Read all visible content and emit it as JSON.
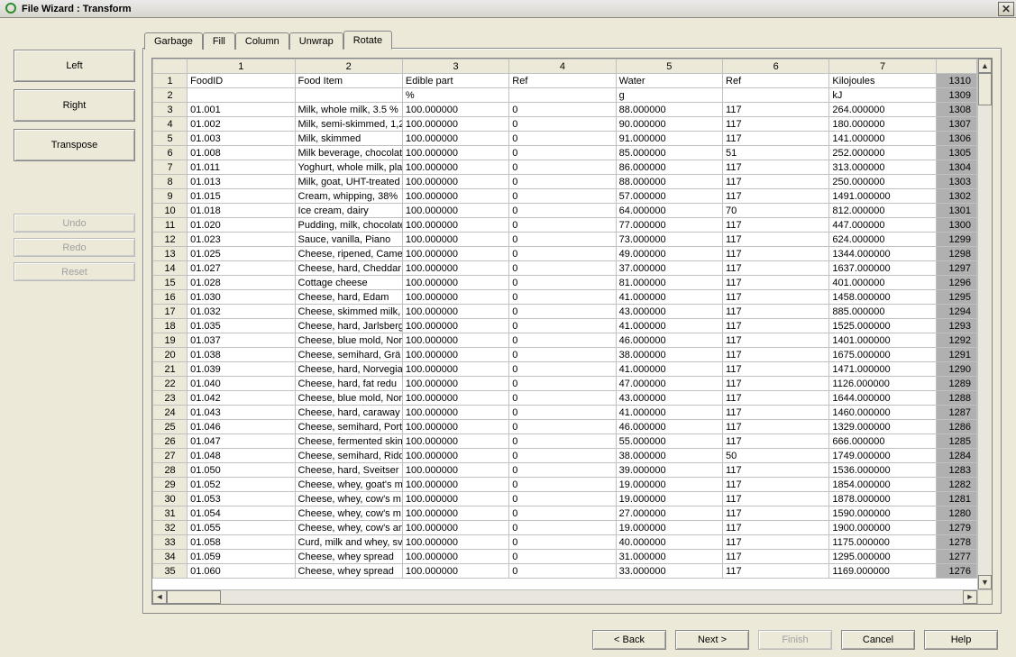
{
  "window": {
    "title": "File Wizard : Transform"
  },
  "sidebar": {
    "buttons": [
      "Left",
      "Right",
      "Transpose"
    ],
    "edit": [
      "Undo",
      "Redo",
      "Reset"
    ]
  },
  "tabs": [
    "Garbage",
    "Fill",
    "Column",
    "Unwrap",
    "Rotate"
  ],
  "active_tab": 4,
  "bottom": {
    "back": "< Back",
    "next": "Next >",
    "finish": "Finish",
    "cancel": "Cancel",
    "help": "Help"
  },
  "grid": {
    "col_headers": [
      "",
      "1",
      "2",
      "3",
      "4",
      "5",
      "6",
      "7",
      ""
    ],
    "counter_start": 1310,
    "rows": [
      {
        "n": "1",
        "c": [
          "FoodID",
          "Food Item",
          "Edible part",
          "Ref",
          "Water",
          "Ref",
          "Kilojoules"
        ]
      },
      {
        "n": "2",
        "c": [
          "",
          "",
          "%",
          "",
          "g",
          "",
          "kJ"
        ]
      },
      {
        "n": "3",
        "c": [
          "01.001",
          "Milk, whole milk, 3.5 %",
          "100.000000",
          "0",
          "88.000000",
          "117",
          "264.000000"
        ]
      },
      {
        "n": "4",
        "c": [
          "01.002",
          "Milk, semi-skimmed, 1,2",
          "100.000000",
          "0",
          "90.000000",
          "117",
          "180.000000"
        ]
      },
      {
        "n": "5",
        "c": [
          "01.003",
          "Milk, skimmed",
          "100.000000",
          "0",
          "91.000000",
          "117",
          "141.000000"
        ]
      },
      {
        "n": "6",
        "c": [
          "01.008",
          "Milk beverage, chocolat",
          "100.000000",
          "0",
          "85.000000",
          "51",
          "252.000000"
        ]
      },
      {
        "n": "7",
        "c": [
          "01.011",
          "Yoghurt, whole milk, pla",
          "100.000000",
          "0",
          "86.000000",
          "117",
          "313.000000"
        ]
      },
      {
        "n": "8",
        "c": [
          "01.013",
          "Milk, goat, UHT-treated",
          "100.000000",
          "0",
          "88.000000",
          "117",
          "250.000000"
        ]
      },
      {
        "n": "9",
        "c": [
          "01.015",
          "Cream, whipping, 38%",
          "100.000000",
          "0",
          "57.000000",
          "117",
          "1491.000000"
        ]
      },
      {
        "n": "10",
        "c": [
          "01.018",
          "Ice cream, dairy",
          "100.000000",
          "0",
          "64.000000",
          "70",
          "812.000000"
        ]
      },
      {
        "n": "11",
        "c": [
          "01.020",
          "Pudding, milk, chocolate",
          "100.000000",
          "0",
          "77.000000",
          "117",
          "447.000000"
        ]
      },
      {
        "n": "12",
        "c": [
          "01.023",
          "Sauce, vanilla, Piano",
          "100.000000",
          "0",
          "73.000000",
          "117",
          "624.000000"
        ]
      },
      {
        "n": "13",
        "c": [
          "01.025",
          "Cheese, ripened, Came",
          "100.000000",
          "0",
          "49.000000",
          "117",
          "1344.000000"
        ]
      },
      {
        "n": "14",
        "c": [
          "01.027",
          "Cheese, hard, Cheddar",
          "100.000000",
          "0",
          "37.000000",
          "117",
          "1637.000000"
        ]
      },
      {
        "n": "15",
        "c": [
          "01.028",
          "Cottage cheese",
          "100.000000",
          "0",
          "81.000000",
          "117",
          "401.000000"
        ]
      },
      {
        "n": "16",
        "c": [
          "01.030",
          "Cheese, hard, Edam",
          "100.000000",
          "0",
          "41.000000",
          "117",
          "1458.000000"
        ]
      },
      {
        "n": "17",
        "c": [
          "01.032",
          "Cheese,  skimmed milk,",
          "100.000000",
          "0",
          "43.000000",
          "117",
          "885.000000"
        ]
      },
      {
        "n": "18",
        "c": [
          "01.035",
          "Cheese, hard, Jarlsberg",
          "100.000000",
          "0",
          "41.000000",
          "117",
          "1525.000000"
        ]
      },
      {
        "n": "19",
        "c": [
          "01.037",
          "Cheese, blue mold, Nor",
          "100.000000",
          "0",
          "46.000000",
          "117",
          "1401.000000"
        ]
      },
      {
        "n": "20",
        "c": [
          "01.038",
          "Cheese, semihard, Grä",
          "100.000000",
          "0",
          "38.000000",
          "117",
          "1675.000000"
        ]
      },
      {
        "n": "21",
        "c": [
          "01.039",
          "Cheese, hard, Norvegia",
          "100.000000",
          "0",
          "41.000000",
          "117",
          "1471.000000"
        ]
      },
      {
        "n": "22",
        "c": [
          "01.040",
          "Cheese, hard, fat redu",
          "100.000000",
          "0",
          "47.000000",
          "117",
          "1126.000000"
        ]
      },
      {
        "n": "23",
        "c": [
          "01.042",
          "Cheese, blue mold, Nor",
          "100.000000",
          "0",
          "43.000000",
          "117",
          "1644.000000"
        ]
      },
      {
        "n": "24",
        "c": [
          "01.043",
          "Cheese, hard, caraway",
          "100.000000",
          "0",
          "41.000000",
          "117",
          "1460.000000"
        ]
      },
      {
        "n": "25",
        "c": [
          "01.046",
          "Cheese, semihard, Port",
          "100.000000",
          "0",
          "46.000000",
          "117",
          "1329.000000"
        ]
      },
      {
        "n": "26",
        "c": [
          "01.047",
          "Cheese, fermented skin",
          "100.000000",
          "0",
          "55.000000",
          "117",
          "666.000000"
        ]
      },
      {
        "n": "27",
        "c": [
          "01.048",
          "Cheese, semihard, Ridd",
          "100.000000",
          "0",
          "38.000000",
          "50",
          "1749.000000"
        ]
      },
      {
        "n": "28",
        "c": [
          "01.050",
          "Cheese, hard, Sveitser",
          "100.000000",
          "0",
          "39.000000",
          "117",
          "1536.000000"
        ]
      },
      {
        "n": "29",
        "c": [
          "01.052",
          "Cheese, whey, goat's m",
          "100.000000",
          "0",
          "19.000000",
          "117",
          "1854.000000"
        ]
      },
      {
        "n": "30",
        "c": [
          "01.053",
          "Cheese, whey, cow's m",
          "100.000000",
          "0",
          "19.000000",
          "117",
          "1878.000000"
        ]
      },
      {
        "n": "31",
        "c": [
          "01.054",
          "Cheese, whey, cow's m",
          "100.000000",
          "0",
          "27.000000",
          "117",
          "1590.000000"
        ]
      },
      {
        "n": "32",
        "c": [
          "01.055",
          "Cheese, whey, cow's an",
          "100.000000",
          "0",
          "19.000000",
          "117",
          "1900.000000"
        ]
      },
      {
        "n": "33",
        "c": [
          "01.058",
          "Curd, milk and whey, sv",
          "100.000000",
          "0",
          "40.000000",
          "117",
          "1175.000000"
        ]
      },
      {
        "n": "34",
        "c": [
          "01.059",
          "Cheese, whey spread",
          "100.000000",
          "0",
          "31.000000",
          "117",
          "1295.000000"
        ]
      },
      {
        "n": "35",
        "c": [
          "01.060",
          "Cheese, whey spread",
          "100.000000",
          "0",
          "33.000000",
          "117",
          "1169.000000"
        ]
      }
    ]
  }
}
